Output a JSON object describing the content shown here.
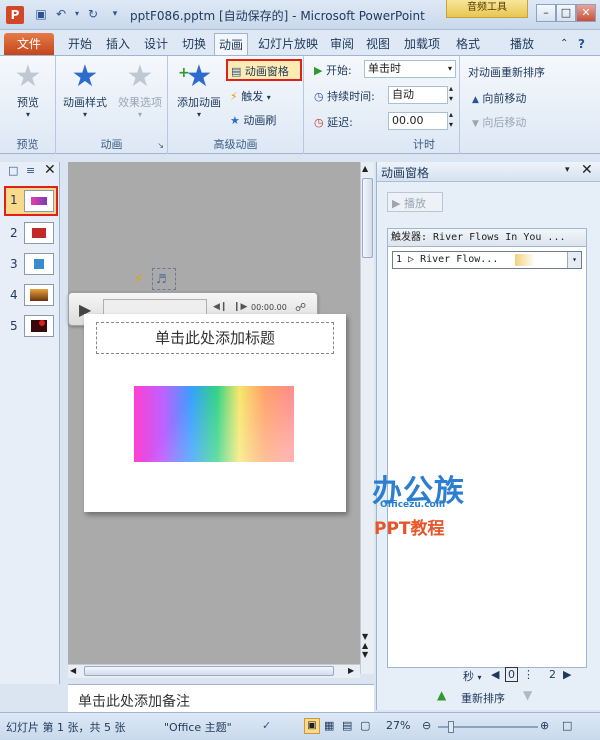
{
  "window": {
    "title": "pptF086.pptm [自动保存的] - Microsoft PowerPoint",
    "context_tab": "音频工具"
  },
  "tabs": {
    "file": "文件",
    "home": "开始",
    "insert": "插入",
    "design": "设计",
    "transitions": "切换",
    "animations": "动画",
    "slideshow": "幻灯片放映",
    "review": "审阅",
    "view": "视图",
    "addins": "加载项",
    "format": "格式",
    "playback": "播放"
  },
  "ribbon": {
    "preview": {
      "button": "预览",
      "group": "预览"
    },
    "animation": {
      "styles": "动画样式",
      "effects": "效果选项",
      "group": "动画"
    },
    "advanced": {
      "add": "添加动画",
      "pane": "动画窗格",
      "trigger": "触发",
      "painter": "动画刷",
      "group": "高级动画"
    },
    "timing": {
      "start_label": "开始:",
      "start_value": "单击时",
      "duration_label": "持续时间:",
      "duration_value": "自动",
      "delay_label": "延迟:",
      "delay_value": "00.00",
      "group": "计时"
    },
    "reorder": {
      "title": "对动画重新排序",
      "earlier": "向前移动",
      "later": "向后移动"
    }
  },
  "slides": {
    "numbers": [
      "1",
      "2",
      "3",
      "4",
      "5"
    ]
  },
  "slide": {
    "title_placeholder": "单击此处添加标题"
  },
  "media": {
    "time": "00:00.00"
  },
  "notes": {
    "placeholder": "单击此处添加备注"
  },
  "anim_pane": {
    "title": "动画窗格",
    "play": "播放",
    "trigger_label": "触发器: River Flows In You ...",
    "item": "1 ▷ River Flow...",
    "seconds": "秒",
    "scale": [
      "0",
      "2"
    ],
    "reorder": "重新排序"
  },
  "status": {
    "slide": "幻灯片 第 1 张，共 5 张",
    "theme": "\"Office 主题\"",
    "zoom": "27%"
  },
  "watermark": {
    "logo": "办公族",
    "site": "Officezu.com",
    "ppt": "PPT教程"
  }
}
